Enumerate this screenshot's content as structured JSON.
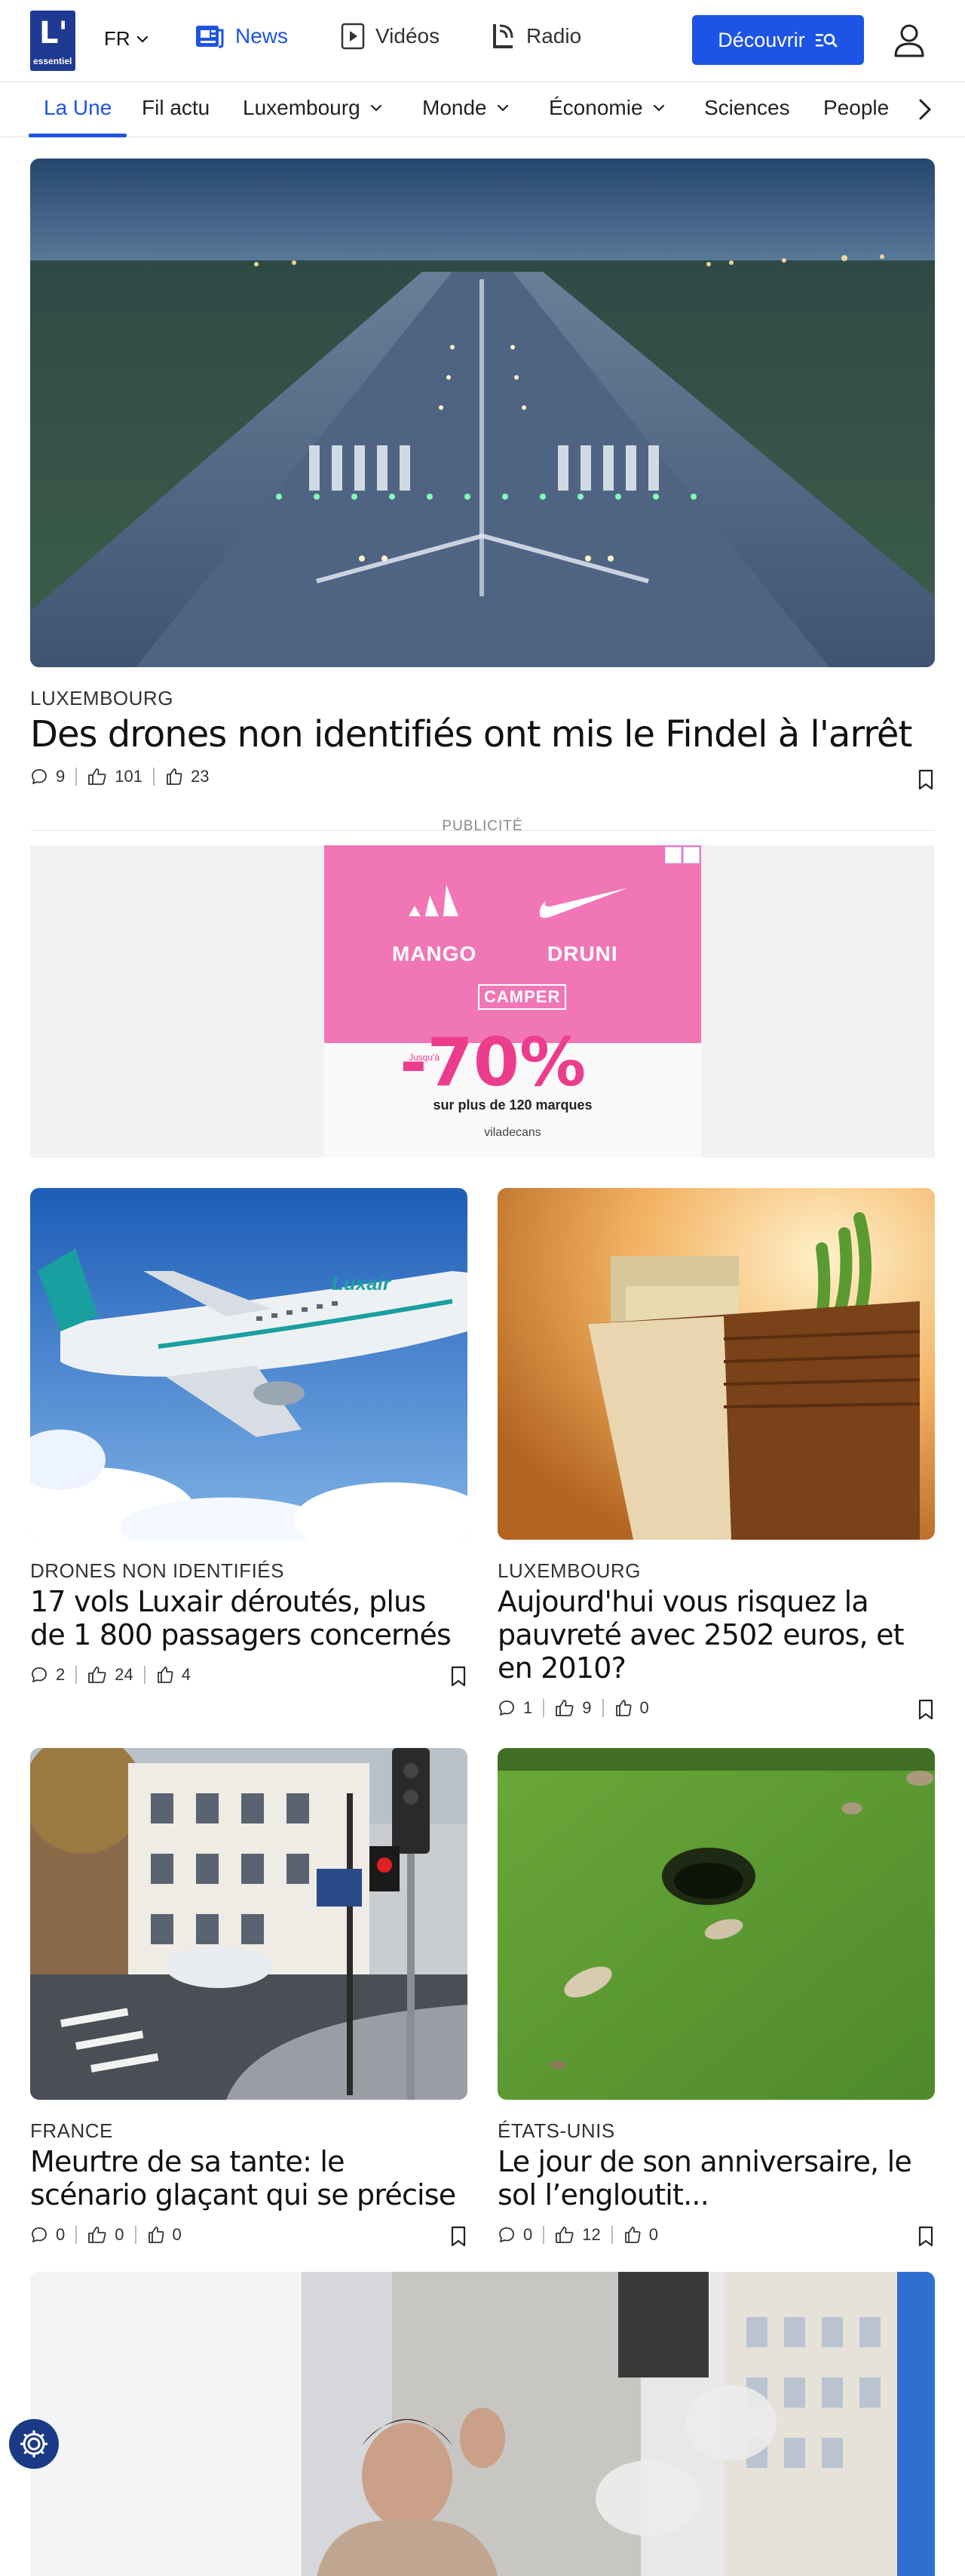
{
  "header": {
    "logo_text": "L'",
    "logo_sub": "essentiel",
    "lang": "FR",
    "nav": {
      "news": "News",
      "videos": "Vidéos",
      "radio": "Radio"
    },
    "discover": "Découvrir"
  },
  "sections": {
    "items": [
      "La Une",
      "Fil actu",
      "Luxembourg",
      "Monde",
      "Économie",
      "Sciences",
      "People"
    ]
  },
  "hero": {
    "category": "LUXEMBOURG",
    "title": "Des drones non identifiés ont mis le Findel à l'arrêt",
    "comments": "9",
    "likes": "101",
    "shares": "23"
  },
  "ad": {
    "label": "PUBLICITÉ",
    "brands": [
      "MANGO",
      "DRUNI",
      "CAMPER"
    ],
    "prefix": "Jusqu'à",
    "discount": "-70%",
    "sub": "sur plus de 120 marques",
    "foot": "viladecans"
  },
  "articles": [
    {
      "category": "DRONES NON IDENTIFIÉS",
      "title": "17 vols Luxair déroutés, plus de 1 800 passagers concernés",
      "comments": "2",
      "likes": "24",
      "shares": "4"
    },
    {
      "category": "LUXEMBOURG",
      "title": "Aujourd'hui vous risquez la pauvreté avec 2502 euros, et en 2010?",
      "comments": "1",
      "likes": "9",
      "shares": "0"
    },
    {
      "category": "FRANCE",
      "title": "Meurtre de sa tante: le scénario glaçant qui se précise",
      "comments": "0",
      "likes": "0",
      "shares": "0"
    },
    {
      "category": "ÉTATS-UNIS",
      "title": "Le jour de son anniversaire, le sol l’engloutit...",
      "comments": "0",
      "likes": "12",
      "shares": "0"
    }
  ],
  "colors": {
    "accent": "#1d54e6",
    "logo": "#1f3a93",
    "ad_pink": "#f176b6"
  },
  "icons": {
    "lang": "chevron-down-icon",
    "news": "newspaper-icon",
    "videos": "play-icon",
    "radio": "radio-icon",
    "discover": "search-icon",
    "user": "user-icon",
    "section_next": "chevron-right-icon",
    "comment": "comment-icon",
    "like": "thumbs-up-icon",
    "share": "share-icon",
    "bookmark": "bookmark-icon",
    "cookie": "gear-icon"
  }
}
